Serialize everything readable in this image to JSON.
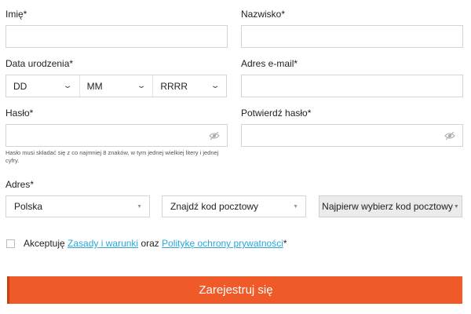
{
  "form": {
    "first_name": {
      "label": "Imię*",
      "value": ""
    },
    "last_name": {
      "label": "Nazwisko*",
      "value": ""
    },
    "birth_date": {
      "label": "Data urodzenia*",
      "day": "DD",
      "month": "MM",
      "year": "RRRR"
    },
    "email": {
      "label": "Adres e-mail*",
      "value": ""
    },
    "password": {
      "label": "Hasło*",
      "value": "",
      "hint": "Hasło musi składać się z co najmniej 8 znaków, w tym jednej wielkiej litery i jednej cyfry."
    },
    "password_confirm": {
      "label": "Potwierdź hasło*",
      "value": ""
    },
    "address": {
      "label": "Adres*",
      "country": "Polska",
      "postcode": "Znajdź kod pocztowy",
      "street_button": "Najpierw wybierz kod pocztowy"
    },
    "terms": {
      "prefix": "Akceptuję",
      "terms_link": "Zasady i warunki",
      "conjunction": "oraz",
      "privacy_link": "Politykę ochrony prywatności",
      "suffix": "*",
      "checked": false
    },
    "submit_label": "Zarejestruj się"
  },
  "icons": {
    "eye": "eye-icon",
    "chevron": "chevron-down-icon",
    "triangle": "triangle-down-icon"
  },
  "colors": {
    "primary": "#f05a28",
    "primary_dark": "#c7410f",
    "link": "#2aa7d8",
    "border": "#d4d4d4",
    "button_bg": "#ebebeb"
  }
}
